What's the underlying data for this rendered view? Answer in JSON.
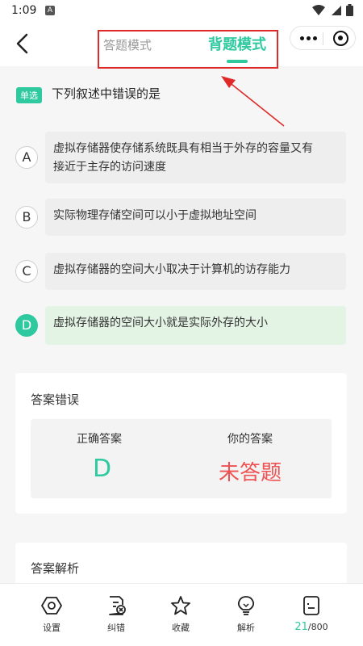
{
  "status_bar": {
    "time": "1:09",
    "notification_badge": "A",
    "icons": [
      "wifi-icon",
      "signal-icon",
      "battery-icon"
    ]
  },
  "navbar": {
    "tab_answer_mode": "答题模式",
    "tab_recite_mode": "背题模式",
    "active_tab": "背题模式",
    "accent_color": "#2fc9a0",
    "highlight_box_color": "#e02a2a"
  },
  "question": {
    "type_badge": "单选",
    "text": "下列叙述中错误的是",
    "options": [
      {
        "letter": "A",
        "line1": "虚拟存储器使存储系统既具有相当于外存的容量又有",
        "line2": "接近于主存的访问速度"
      },
      {
        "letter": "B",
        "text": "实际物理存储空间可以小于虚拟地址空间"
      },
      {
        "letter": "C",
        "text": "虚拟存储器的空间大小取决于计算机的访存能力"
      },
      {
        "letter": "D",
        "text": "虚拟存储器的空间大小就是实际外存的大小",
        "selected": true
      }
    ]
  },
  "result": {
    "title": "答案错误",
    "correct_label": "正确答案",
    "correct_value": "D",
    "your_label": "你的答案",
    "your_value": "未答题",
    "correct_color": "#2fc9a0",
    "wrong_color": "#ee5252"
  },
  "explanation": {
    "title": "答案解析"
  },
  "bottom_bar": {
    "items": [
      {
        "label": "设置",
        "icon": "settings-icon"
      },
      {
        "label": "纠错",
        "icon": "report-error-icon"
      },
      {
        "label": "收藏",
        "icon": "star-icon"
      },
      {
        "label": "解析",
        "icon": "lightbulb-icon"
      }
    ],
    "progress_current": "21",
    "progress_total": "/800",
    "progress_icon": "question-list-icon"
  }
}
